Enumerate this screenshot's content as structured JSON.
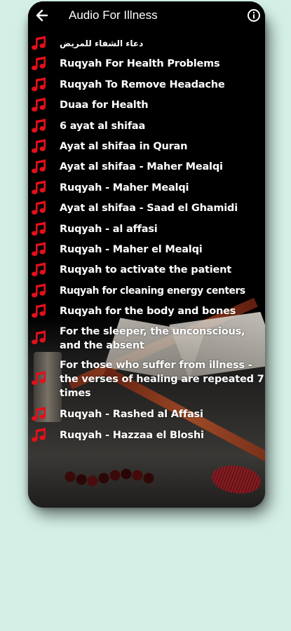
{
  "colors": {
    "page_background": "#d3efe6",
    "phone_background": "#000000",
    "note_icon": "#e2101a",
    "text": "#ffffff"
  },
  "header": {
    "back_icon": "arrow-left-icon",
    "title": "Audio For Illness",
    "info_icon": "info-icon"
  },
  "list": {
    "icon": "music-note-icon",
    "items": [
      {
        "label": "دعاء الشفاء للمريض"
      },
      {
        "label": "Ruqyah For Health Problems"
      },
      {
        "label": "Ruqyah To Remove Headache"
      },
      {
        "label": "Duaa for Health"
      },
      {
        "label": "6 ayat al shifaa"
      },
      {
        "label": "Ayat al shifaa in Quran"
      },
      {
        "label": "Ayat al shifaa - Maher Mealqi"
      },
      {
        "label": "Ruqyah - Maher Mealqi"
      },
      {
        "label": "Ayat al shifaa - Saad el Ghamidi"
      },
      {
        "label": "Ruqyah - al affasi"
      },
      {
        "label": "Ruqyah - Maher el Mealqi"
      },
      {
        "label": "Ruqyah to activate the patient"
      },
      {
        "label": "Ruqyah for cleaning energy centers"
      },
      {
        "label": "Ruqyah for the body and bones"
      },
      {
        "label": "For the sleeper, the unconscious, and the absent"
      },
      {
        "label": "For those who suffer from illness - the verses of healing are repeated 7 times"
      },
      {
        "label": "Ruqyah - Rashed al Affasi"
      },
      {
        "label": "Ruqyah - Hazzaa el Bloshi"
      }
    ]
  }
}
